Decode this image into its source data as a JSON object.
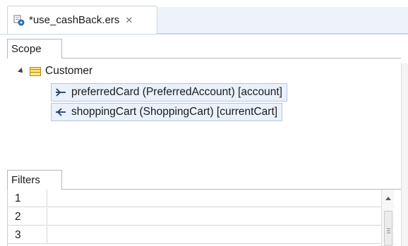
{
  "editor": {
    "tab_label": "*use_cashBack.ers",
    "close_glyph": "✕",
    "doc_icon": "rule-editor-icon"
  },
  "scope": {
    "tab_label": "Scope",
    "tree": {
      "root_label": "Customer",
      "root_icon": "table-icon",
      "children": [
        {
          "label": "preferredCard (PreferredAccount) [account]",
          "icon": "outgoing-relation-icon"
        },
        {
          "label": "shoppingCart (ShoppingCart) [currentCart]",
          "icon": "incoming-relation-icon"
        }
      ]
    }
  },
  "filters": {
    "tab_label": "Filters",
    "rows": [
      {
        "num": "1",
        "value": ""
      },
      {
        "num": "2",
        "value": ""
      },
      {
        "num": "3",
        "value": ""
      }
    ]
  },
  "colors": {
    "selection_bg": "#eaf1fb",
    "selection_border": "#b2c6e6",
    "table_icon_fill": "#ffe58a"
  }
}
